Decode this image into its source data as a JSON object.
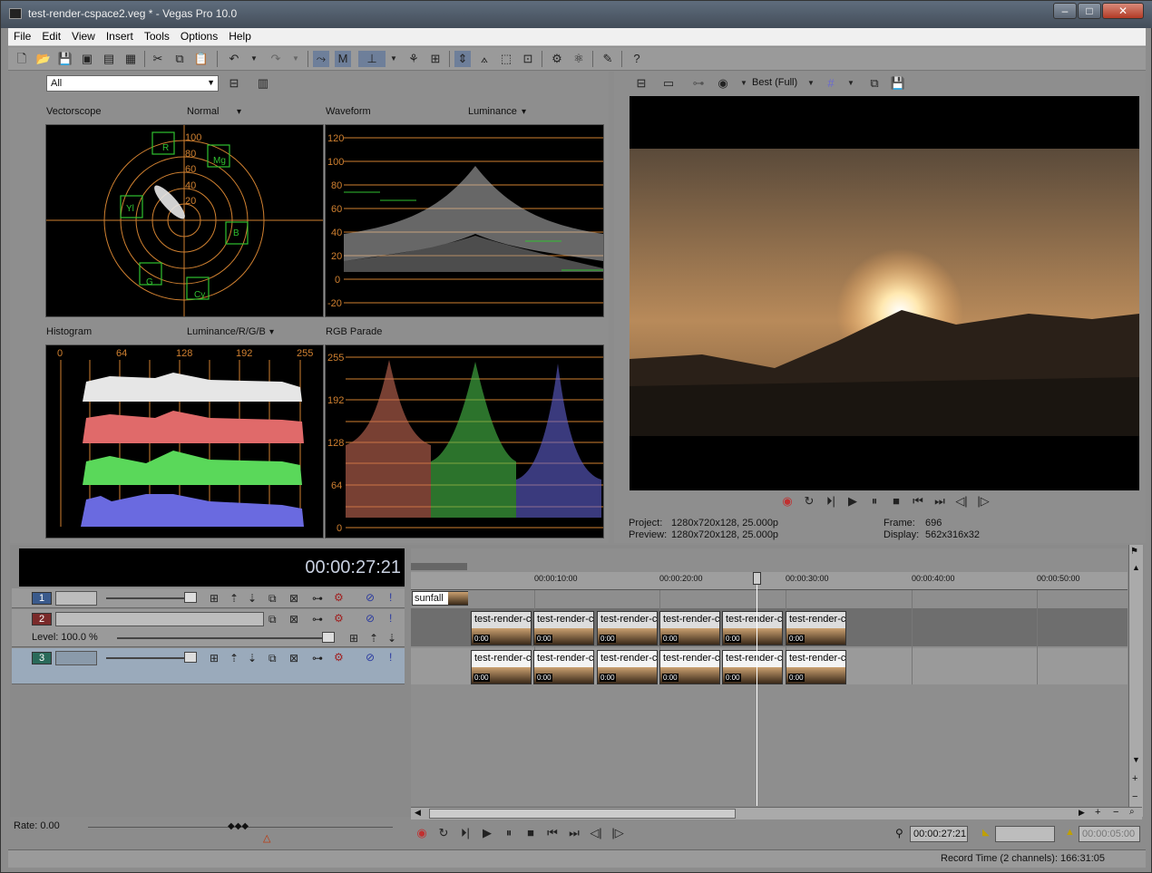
{
  "window": {
    "title": "test-render-cspace2.veg * - Vegas Pro 10.0",
    "minimize": "–",
    "maximize": "□",
    "close": "✕"
  },
  "menu": [
    "File",
    "Edit",
    "View",
    "Insert",
    "Tools",
    "Options",
    "Help"
  ],
  "scopes_toolbar": {
    "filter": "All"
  },
  "vectorscope": {
    "label": "Vectorscope",
    "mode": "Normal",
    "rings": [
      "100",
      "80",
      "60",
      "40",
      "20"
    ],
    "targets": [
      "R",
      "Mg",
      "B",
      "Cy",
      "G",
      "Yl"
    ]
  },
  "waveform": {
    "label": "Waveform",
    "mode": "Luminance",
    "ticks": [
      "120",
      "100",
      "80",
      "60",
      "40",
      "20",
      "0",
      "-20"
    ]
  },
  "histogram": {
    "label": "Histogram",
    "mode": "Luminance/R/G/B",
    "ticks": [
      "0",
      "64",
      "128",
      "192",
      "255"
    ]
  },
  "parade": {
    "label": "RGB Parade",
    "ticks": [
      "255",
      "192",
      "128",
      "64",
      "0"
    ]
  },
  "preview": {
    "quality": "Best (Full)",
    "project_label": "Project:",
    "project": "1280x720x128, 25.000p",
    "preview_label": "Preview:",
    "preview": "1280x720x128, 25.000p",
    "frame_label": "Frame:",
    "frame": "696",
    "display_label": "Display:",
    "display": "562x316x32"
  },
  "timeline": {
    "timecode": "00:00:27:21",
    "ruler": [
      "00:00:10:00",
      "00:00:20:00",
      "00:00:30:00",
      "00:00:40:00",
      "00:00:50:00"
    ],
    "marker": "sunfall",
    "tracks": [
      {
        "num": "1",
        "color": "#3a5a8c"
      },
      {
        "num": "2",
        "color": "#7a2a2a",
        "level": "Level: 100.0 %"
      },
      {
        "num": "3",
        "color": "#2a6a5a"
      }
    ],
    "clip_title": "test-render-c",
    "clip_tc": "0:00"
  },
  "bottom": {
    "rate": "Rate: 0.00",
    "cursor_time": "00:00:27:21",
    "end_time": "00:00:05:00",
    "record_time": "Record Time (2 channels): 166:31:05"
  }
}
